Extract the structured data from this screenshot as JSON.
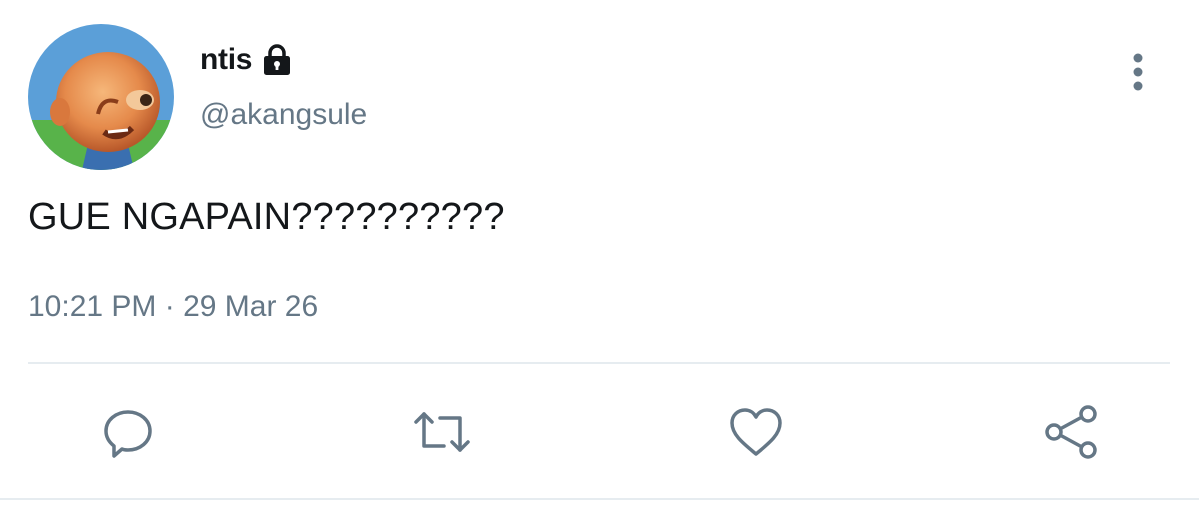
{
  "author": {
    "display_name": "ntis",
    "handle": "@akangsule",
    "protected": true
  },
  "tweet": {
    "text": "GUE NGAPAIN??????????",
    "timestamp": "10:21 PM · 29 Mar 26"
  },
  "icons": {
    "lock": "lock-icon",
    "more": "more-vertical-icon",
    "reply": "reply-icon",
    "retweet": "retweet-icon",
    "like": "heart-icon",
    "share": "share-icon"
  },
  "colors": {
    "text_primary": "#14171a",
    "text_secondary": "#657786",
    "divider": "#e6ecf0"
  }
}
